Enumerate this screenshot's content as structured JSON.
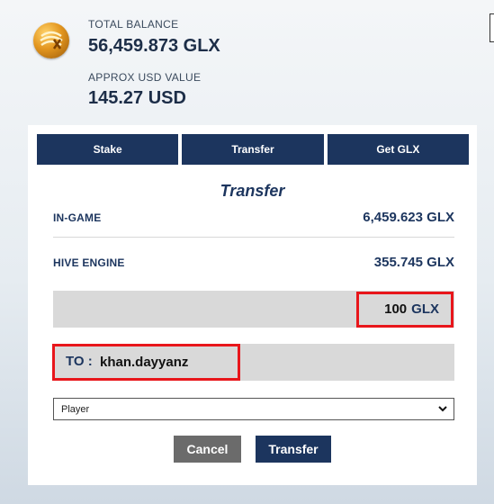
{
  "header": {
    "logo_name": "glx-coin-logo",
    "total_balance_label": "TOTAL BALANCE",
    "total_balance_value": "56,459.873 GLX",
    "usd_label": "APPROX USD VALUE",
    "usd_value": "145.27 USD"
  },
  "tabs": [
    {
      "label": "Stake"
    },
    {
      "label": "Transfer"
    },
    {
      "label": "Get GLX"
    }
  ],
  "transfer": {
    "title": "Transfer",
    "in_game_label": "IN-GAME",
    "in_game_value": "6,459.623 GLX",
    "hive_engine_label": "HIVE ENGINE",
    "hive_engine_value": "355.745 GLX",
    "amount_value": "100",
    "amount_unit": "GLX",
    "to_label": "TO :",
    "to_value": "khan.dayyanz",
    "select_value": "Player"
  },
  "buttons": {
    "cancel": "Cancel",
    "submit": "Transfer"
  },
  "colors": {
    "navy": "#1c355e",
    "highlight_red": "#e8161b",
    "cancel_gray": "#6b6b6b"
  }
}
